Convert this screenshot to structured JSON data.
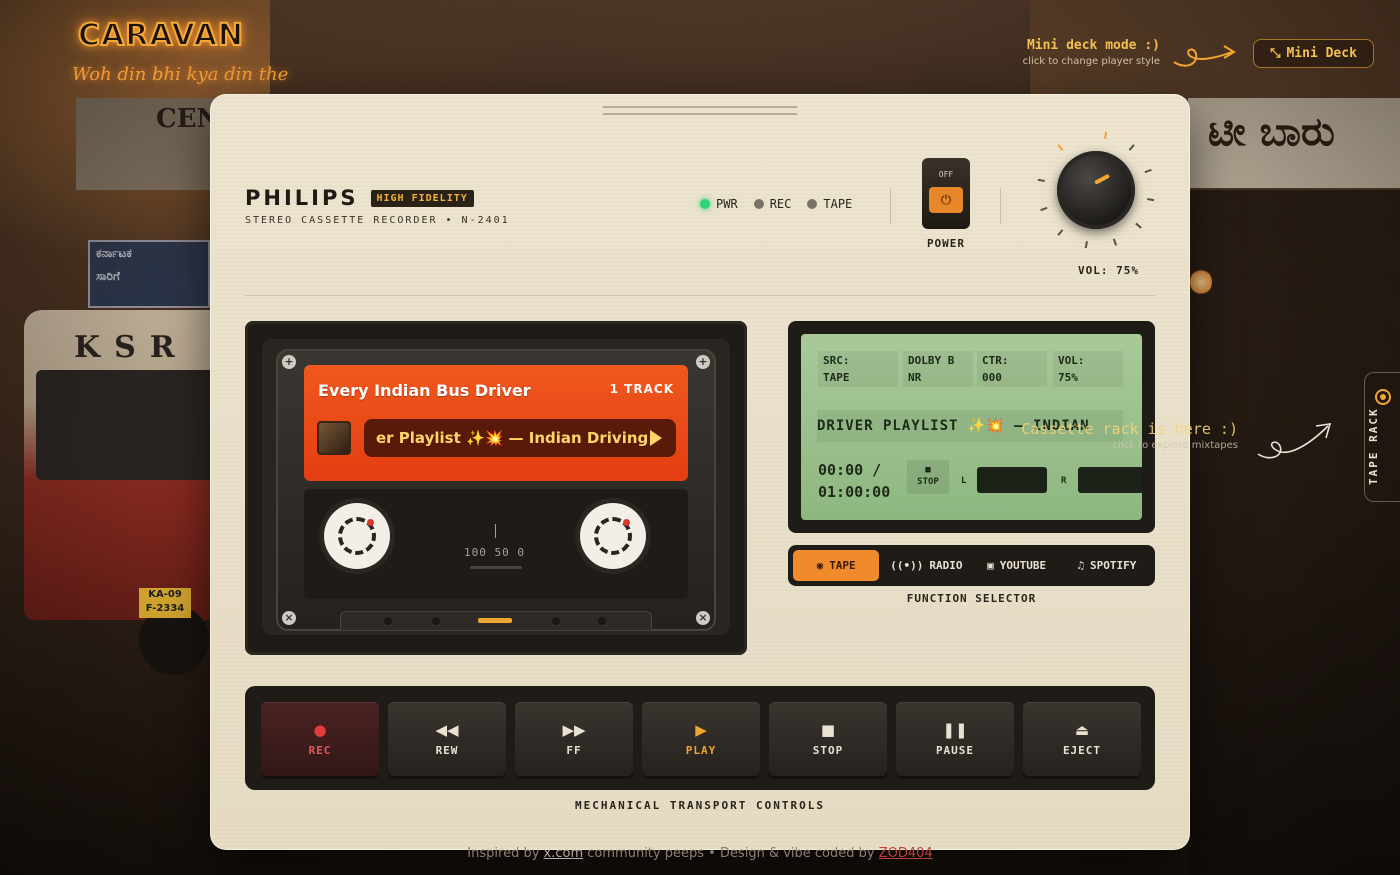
{
  "app": {
    "logo": "CARAVAN",
    "tagline": "Woh din bhi kya din the"
  },
  "mini_deck": {
    "hint_title": "Mini deck mode :)",
    "hint_sub": "click to change player style",
    "button_label": "Mini Deck"
  },
  "device": {
    "brand": "PHILIPS",
    "badge": "HIGH FIDELITY",
    "model": "STEREO CASSETTE RECORDER • N-2401",
    "leds": [
      {
        "label": "PWR",
        "on": true
      },
      {
        "label": "REC",
        "on": false
      },
      {
        "label": "TAPE",
        "on": false
      }
    ],
    "power": {
      "off_label": "OFF",
      "label": "POWER"
    },
    "volume": {
      "label": "VOL: 75%",
      "level_percent": 75
    }
  },
  "cassette": {
    "title": "Every Indian Bus Driver",
    "tracks": "1 TRACK",
    "now_playing": "er Playlist ✨💥 — Indian Driving",
    "counter": "100 50 0"
  },
  "lcd": {
    "src_label": "SRC:",
    "src_value": "TAPE",
    "dolby_label": "DOLBY B",
    "dolby_value": "NR",
    "ctr_label": "CTR:",
    "ctr_value": "000",
    "vol_label": "VOL:",
    "vol_value": "75%",
    "marquee": "DRIVER PLAYLIST ✨💥 — INDIAN",
    "time_elapsed": "00:00 /",
    "time_total": "01:00:00",
    "state_icon": "■",
    "state_label": "STOP",
    "left_channel": "L",
    "right_channel": "R"
  },
  "function_selector": {
    "label": "FUNCTION SELECTOR",
    "options": [
      {
        "label": "TAPE",
        "icon": "cassette-icon",
        "active": true
      },
      {
        "label": "RADIO",
        "icon": "radio-icon",
        "active": false
      },
      {
        "label": "YOUTUBE",
        "icon": "youtube-icon",
        "active": false
      },
      {
        "label": "SPOTIFY",
        "icon": "music-note-icon",
        "active": false
      }
    ]
  },
  "transport": {
    "label": "MECHANICAL TRANSPORT CONTROLS",
    "buttons": [
      {
        "label": "REC",
        "icon": "●"
      },
      {
        "label": "REW",
        "icon": "◀◀"
      },
      {
        "label": "FF",
        "icon": "▶▶"
      },
      {
        "label": "PLAY",
        "icon": "▶"
      },
      {
        "label": "STOP",
        "icon": "■"
      },
      {
        "label": "PAUSE",
        "icon": "❚❚"
      },
      {
        "label": "EJECT",
        "icon": "⏏"
      }
    ]
  },
  "tape_rack": {
    "hint_title": "Cassette rack is here :)",
    "hint_sub": "click to explore mixtapes",
    "tab_label": "TAPE RACK"
  },
  "footer": {
    "prefix": "Inspired by",
    "link": "x.com",
    "middle": "community peeps  •  Design & vibe coded by",
    "author": "ZOD404"
  },
  "colors": {
    "accent": "#f08a2b",
    "lcd_green": "#a9c99a",
    "body_cream": "#ede4cf",
    "label_orange": "#e43e12"
  }
}
